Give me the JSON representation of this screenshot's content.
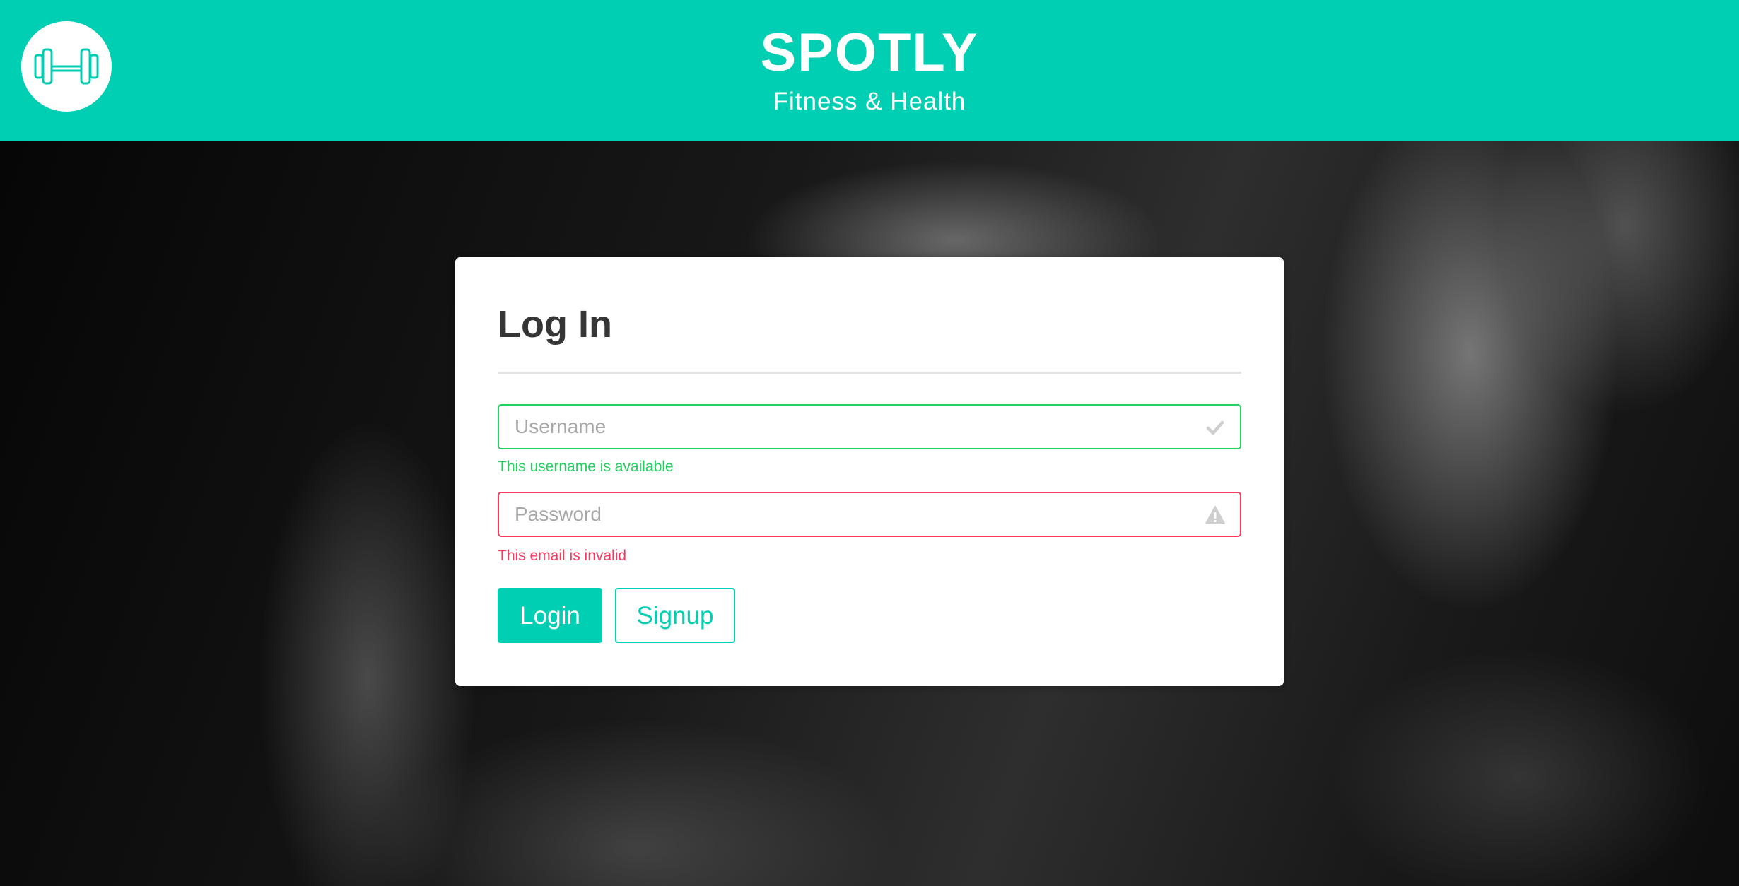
{
  "header": {
    "logo_icon": "dumbbell-icon",
    "title": "SPOTLY",
    "subtitle": "Fitness & Health",
    "background_color": "#00cfb3"
  },
  "login_card": {
    "title": "Log In",
    "username": {
      "value": "",
      "placeholder": "Username",
      "status_icon": "checkmark-icon",
      "help_text": "This username is available",
      "state_color": "#23d160"
    },
    "password": {
      "value": "",
      "placeholder": "Password",
      "status_icon": "warning-icon",
      "help_text": "This email is invalid",
      "state_color": "#ff3860"
    },
    "login_label": "Login",
    "signup_label": "Signup"
  }
}
